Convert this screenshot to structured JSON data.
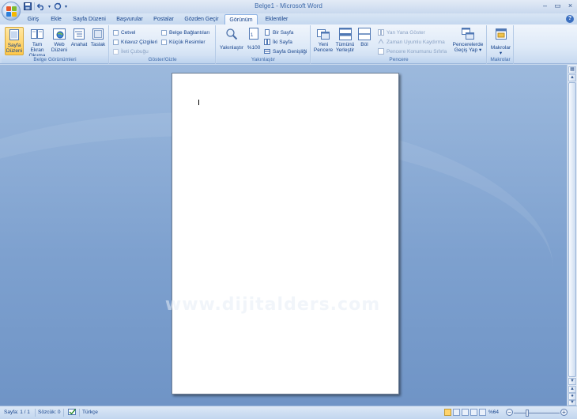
{
  "window": {
    "title": "Belge1 - Microsoft Word",
    "minimize": "–",
    "maximize": "▭",
    "close": "×"
  },
  "quick_access": {
    "save_icon": "save-icon",
    "undo_icon": "undo-icon",
    "redo_icon": "redo-icon",
    "customize": "▾"
  },
  "tabs": [
    {
      "label": "Giriş",
      "active": false
    },
    {
      "label": "Ekle",
      "active": false
    },
    {
      "label": "Sayfa Düzeni",
      "active": false
    },
    {
      "label": "Başvurular",
      "active": false
    },
    {
      "label": "Postalar",
      "active": false
    },
    {
      "label": "Gözden Geçir",
      "active": false
    },
    {
      "label": "Görünüm",
      "active": true
    },
    {
      "label": "Eklentiler",
      "active": false
    }
  ],
  "help_label": "?",
  "ribbon": {
    "belge_gorunumleri": {
      "label": "Belge Görünümleri",
      "buttons": [
        {
          "label1": "Sayfa",
          "label2": "Düzeni",
          "icon": "page-layout-icon",
          "selected": true
        },
        {
          "label1": "Tam Ekran",
          "label2": "Okuma",
          "icon": "full-screen-reading-icon",
          "selected": false
        },
        {
          "label1": "Web",
          "label2": "Düzeni",
          "icon": "web-layout-icon",
          "selected": false
        },
        {
          "label1": "Anahat",
          "label2": "",
          "icon": "outline-icon",
          "selected": false
        },
        {
          "label1": "Taslak",
          "label2": "",
          "icon": "draft-icon",
          "selected": false
        }
      ]
    },
    "goster_gizle": {
      "label": "Göster/Gizle",
      "checkboxes": [
        {
          "label": "Cetvel",
          "checked": false,
          "disabled": false
        },
        {
          "label": "Kılavuz Çizgileri",
          "checked": false,
          "disabled": false
        },
        {
          "label": "İleti Çubuğu",
          "checked": false,
          "disabled": true
        },
        {
          "label": "Belge Bağlantıları",
          "checked": false,
          "disabled": false
        },
        {
          "label": "Küçük Resimler",
          "checked": false,
          "disabled": false
        }
      ]
    },
    "yakinlastir": {
      "label": "Yakınlaştır",
      "zoom_button": "Yakınlaştır",
      "hundred_button": "%100",
      "options": [
        "Bir Sayfa",
        "İki Sayfa",
        "Sayfa Genişliği"
      ]
    },
    "pencere": {
      "label": "Pencere",
      "buttons": [
        {
          "label1": "Yeni",
          "label2": "Pencere"
        },
        {
          "label1": "Tümünü",
          "label2": "Yerleştir"
        },
        {
          "label1": "Böl",
          "label2": ""
        }
      ],
      "options": [
        "Yan Yana Göster",
        "Zaman Uyumlu Kaydırma",
        "Pencere Konumunu Sıfırla"
      ],
      "switch_label1": "Pencerelerde",
      "switch_label2": "Geçiş Yap ▾"
    },
    "makrolar": {
      "label": "Makrolar",
      "button_label": "Makrolar",
      "arrow": "▾"
    }
  },
  "watermark": "www.dijitalders.com",
  "status": {
    "page": "Sayfa: 1 / 1",
    "words": "Sözcük: 0",
    "language": "Türkçe",
    "zoom": "%64",
    "zoom_minus": "−",
    "zoom_plus": "+"
  },
  "colors": {
    "accent": "#15428b",
    "selected": "#ffc84a",
    "document_bg": "#7ea1cf"
  }
}
